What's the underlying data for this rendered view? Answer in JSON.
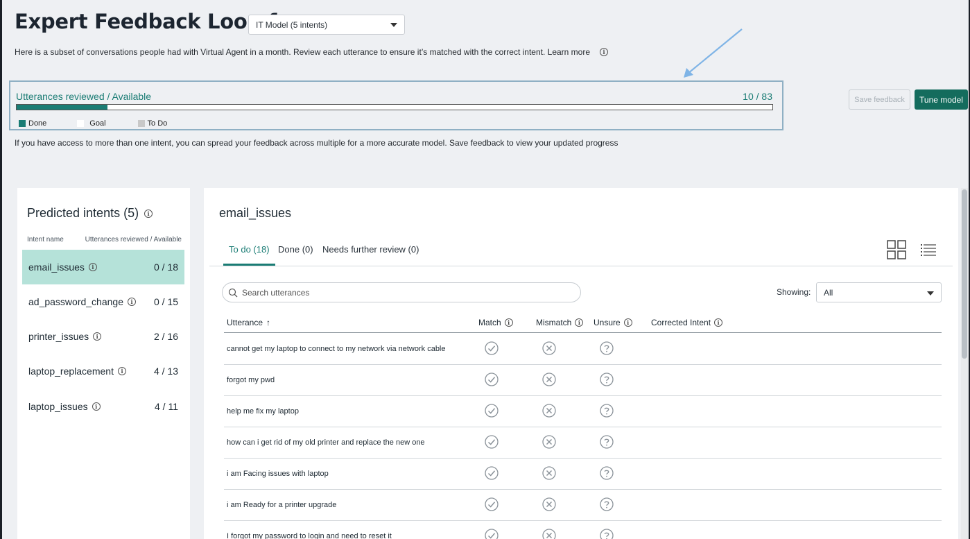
{
  "header": {
    "title": "Expert Feedback Loop for",
    "model_select": "IT Model (5 intents)",
    "intro": "Here is a subset of conversations people had with Virtual Agent in a month. Review each utterance to ensure it’s matched with the correct intent. Learn more"
  },
  "progress": {
    "label": "Utterances reviewed / Available",
    "count": "10 / 83",
    "fraction_done": 0.12,
    "legend": {
      "done": "Done",
      "goal": "Goal",
      "todo": "To Do"
    },
    "colors": {
      "done": "#1a7c74",
      "goal": "#ffffff",
      "todo": "#c8c8c8"
    }
  },
  "actions": {
    "save_feedback": "Save feedback",
    "tune_model": "Tune model"
  },
  "spread_note": "If you have access to more than one intent, you can spread your feedback across multiple for a more accurate model. Save feedback to view your updated progress",
  "sidebar": {
    "title": "Predicted intents (5)",
    "col_intent": "Intent name",
    "col_reviewed": "Utterances reviewed / Available",
    "items": [
      {
        "name": "email_issues",
        "count": "0 / 18"
      },
      {
        "name": "ad_password_change",
        "count": "0 / 15"
      },
      {
        "name": "printer_issues",
        "count": "2 / 16"
      },
      {
        "name": "laptop_replacement",
        "count": "4 / 13"
      },
      {
        "name": "laptop_issues",
        "count": "4 / 11"
      }
    ]
  },
  "main": {
    "heading": "email_issues",
    "tabs": [
      "To do (18)",
      "Done (0)",
      "Needs further review (0)"
    ],
    "search_placeholder": "Search utterances",
    "showing_label": "Showing:",
    "showing_value": "All",
    "columns": {
      "utterance": "Utterance",
      "match": "Match",
      "mismatch": "Mismatch",
      "unsure": "Unsure",
      "corrected": "Corrected Intent"
    },
    "rows": [
      "cannot get my laptop to connect to my network via network cable",
      "forgot my pwd",
      "help me fix my laptop",
      "how can i get rid of my old printer and replace the new one",
      "i am Facing issues with laptop",
      "i am Ready for a printer upgrade",
      "I forgot my password to login and need to reset it"
    ]
  },
  "accent": "#1a7c74"
}
